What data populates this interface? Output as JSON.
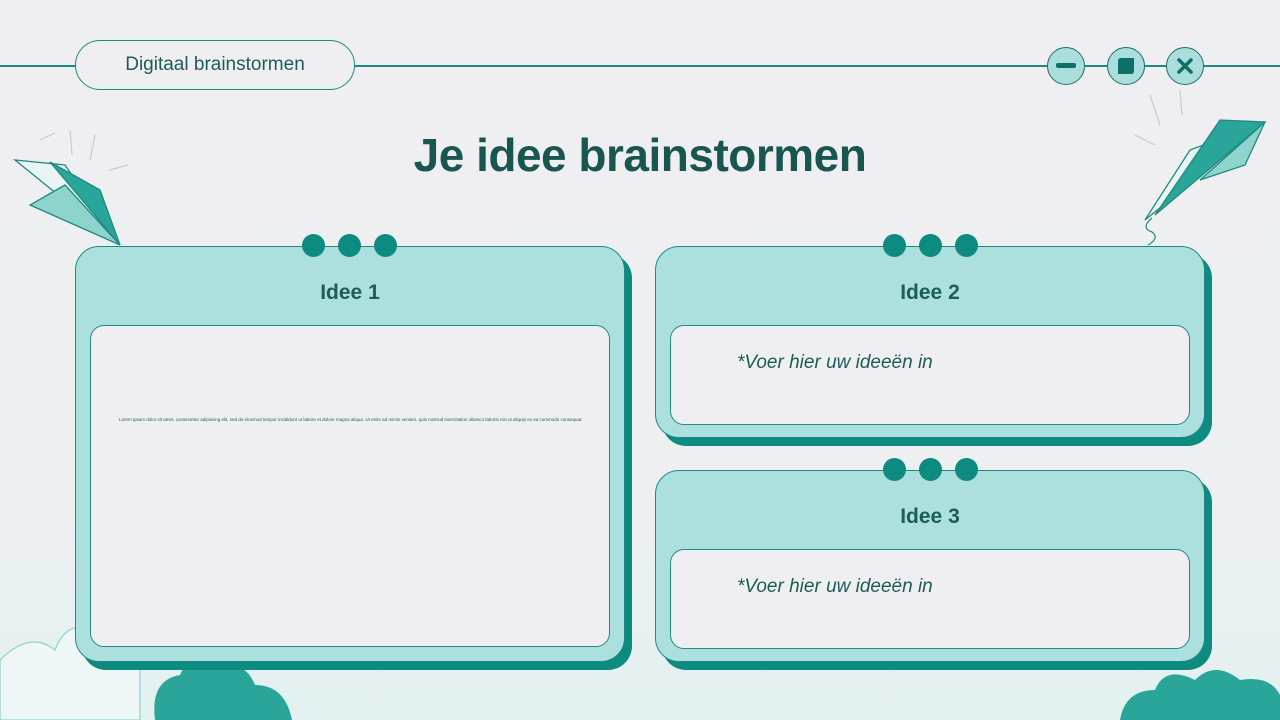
{
  "window": {
    "tab_label": "Digitaal brainstormen",
    "controls": {
      "minimize_icon": "minus-icon",
      "maximize_icon": "square-icon",
      "close_icon": "x-icon"
    }
  },
  "slide": {
    "title": "Je idee brainstormen",
    "cards": [
      {
        "title": "Idee 1",
        "body": "Lorem ipsum dolor sit amet, consectetur adipiscing elit, sed do eiusmod tempor incididunt ut labore et dolore magna aliqua. Ut enim ad minim veniam, quis nostrud exercitation ullamco laboris nisi ut aliquip ex ea commodo consequat."
      },
      {
        "title": "Idee 2",
        "placeholder": "*Voer hier uw ideeën in"
      },
      {
        "title": "Idee 3",
        "placeholder": "*Voer hier uw ideeën in"
      }
    ]
  },
  "colors": {
    "accent": "#0e8b80",
    "card_fill": "#abe0df",
    "text": "#1d5c57",
    "background": "#efeff1"
  }
}
